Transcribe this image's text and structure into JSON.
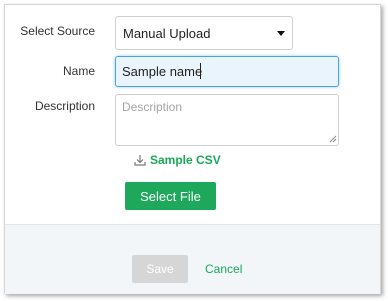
{
  "form": {
    "source_label": "Select Source",
    "source_value": "Manual Upload",
    "name_label": "Name",
    "name_value": "Sample name",
    "description_label": "Description",
    "description_placeholder": "Description",
    "sample_csv_label": "Sample CSV",
    "select_file_label": "Select File"
  },
  "footer": {
    "save_label": "Save",
    "cancel_label": "Cancel"
  },
  "icons": {
    "sample_csv": "download-icon",
    "source_dropdown": "caret-down-icon"
  },
  "colors": {
    "accent_green": "#1ea85c",
    "link_green": "#18a957",
    "focus_blue": "#4da3e0",
    "disabled_gray": "#d6d6d6"
  }
}
